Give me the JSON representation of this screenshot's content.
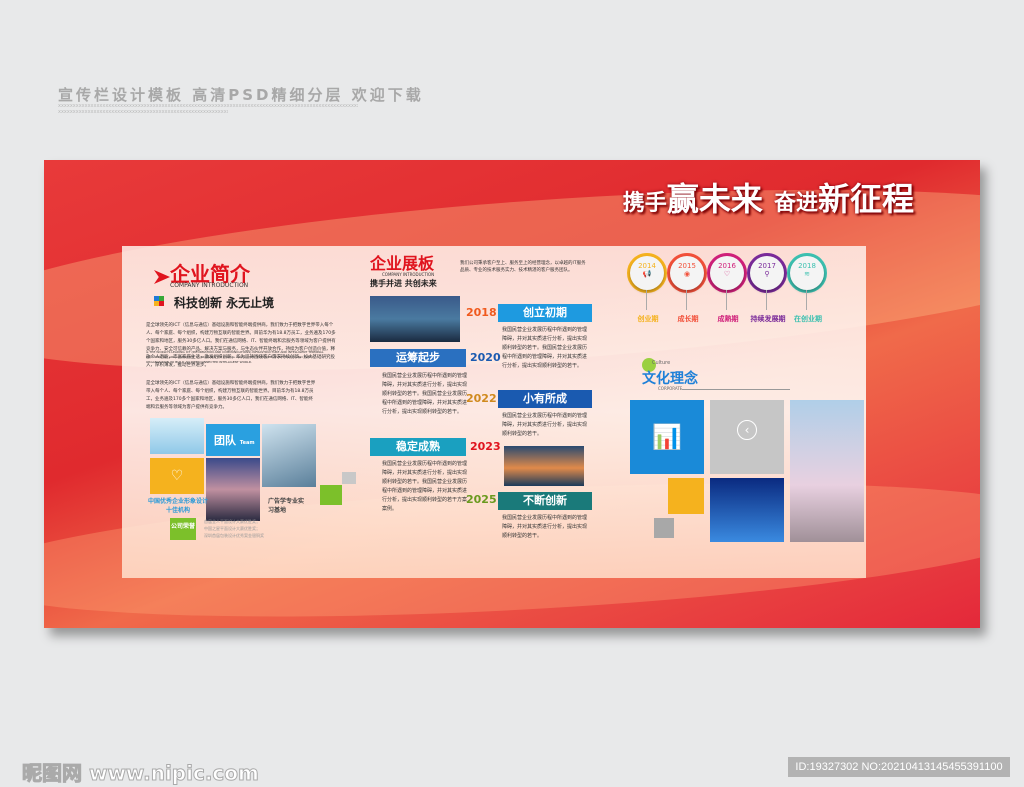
{
  "header": {
    "title": "宣传栏设计模板 高清PSD精细分层 欢迎下载",
    "filler": "xxxxxxxxxxxxxxxxxxxxxxxxxxxxxxxxxxxxxxxxxxxxxxxxxxxxxxxxxxxxxxxxxxxxxxxxxxxxxxxxxxxxxxxxxxxxxxxxxxxxxxxx"
  },
  "slogan": {
    "p1": "携手",
    "p2": "赢未来",
    "p3": "奋进",
    "p4": "新征程"
  },
  "intro": {
    "title": "企业简介",
    "en": "COMPANY INTRODUCTION",
    "subtitle": "科技创新 永无止境",
    "body1": "是全球领先的ICT（信息与通信）基础设施和智能终端提供商，我们致力于把数字世界带入每个人、每个家庭、每个组织，构建万物互联的智能世界。目前华为有18.8万员工，业务遍及170多个国家和地区，服务30多亿人口。我们在通信网络、IT、智能终端和云服务等领域为客户提供有竞争力、安全可信赖的产品、解决方案与服务，与生态伙伴开放合作，持续为客户创造价值，释放个人潜能，丰富家庭生活，激发组织创新。华为坚持围绕客户需求持续创新，加大基础研究投入，厚积薄发，推动世界进步。",
    "body_en": "is THE WORLD'S LEADING ICT (INFORMATION AND COMMUNICATIONS) INFRASTRUCTURE AND INTELLIGENT TERMINAL PROVIDER. WE ARE COMMITTED TO BRINGING THE DIGITAL WORLD INTO EVERYONE, EVERY FAMILY AND EVERY ORGANIZATION TO BUILD AN INTERCONNECTED INTELLIGENT WORLD.",
    "body2": "是全球领先的ICT（信息与通信）基础设施和智能终端提供商，我们致力于把数字世界带入每个人、每个家庭、每个组织，构建万物互联的智能世界。目前华为有18.8万员工，业务遍及170多个国家和地区，服务30多亿人口，我们在通信网络、IT、智能终端和云服务等领域为客户提供有竞争力。",
    "team": "团队",
    "team_en": "Team",
    "award": "中国优秀企业形象设计十佳机构",
    "base": "广告学专业实习基地",
    "honor": "公司荣誉",
    "honor_lines": [
      "首届全人平面设计大赛优胜奖；",
      "中国之星平面设计大赛优胜奖；",
      "深圳首届包装设计优秀案金银铜奖"
    ]
  },
  "board": {
    "title": "企业展板",
    "en": "COMPANY INTRODUCTION",
    "subtitle": "携手并进 共创未来",
    "desc": "我们公司秉承客户至上、服务至上的经营理念，以卓越的IT服务品质、专业的技术服务实力、技术精湛的客户服务团队。",
    "timeline": [
      {
        "year": "2018",
        "stage": "创立初期",
        "text": "我国民营企业发展历程中所遇到的管理障碍，并对其实质进行分析，提出实现顺利转型的若干。我国民营企业发展历程中所遇到的管理障碍，并对其实质进行分析，提出实现顺利转型的若干。"
      },
      {
        "year": "2020",
        "stage": "运筹起步",
        "text": "我国民营企业发展历程中所遇到的管理障碍，并对其实质进行分析，提出实现顺利转型的若干。我国民营企业发展历程中所遇到的管理障碍，并对其实质进行分析，提出实现顺利转型的若干。"
      },
      {
        "year": "2022",
        "stage": "小有所成",
        "text": "我国民营企业发展历程中所遇到的管理障碍，并对其实质进行分析，提出实现顺利转型的若干。"
      },
      {
        "year": "2023",
        "stage": "稳定成熟",
        "text": "我国民营企业发展历程中所遇到的管理障碍，并对其实质进行分析，提出实现顺利转型的若干。我国民营企业发展历程中所遇到的管理障碍，并对其实质进行分析，提出实现顺利转型的若干方案案例。"
      },
      {
        "year": "2025",
        "stage": "不断创新",
        "text": "我国民营企业发展历程中所遇到的管理障碍，并对其实质进行分析，提出实现顺利转型的若干。"
      }
    ]
  },
  "milestones": [
    {
      "year": "2014",
      "label": "创业期",
      "color": "#f5b21e",
      "icon": "megaphone-icon",
      "glyph": "📢"
    },
    {
      "year": "2015",
      "label": "成长期",
      "color": "#f2503a",
      "icon": "eye-icon",
      "glyph": "◉"
    },
    {
      "year": "2016",
      "label": "成熟期",
      "color": "#d0207a",
      "icon": "heart-icon",
      "glyph": "♡"
    },
    {
      "year": "2017",
      "label": "持续发展期",
      "color": "#7a2a9a",
      "icon": "magnifier-icon",
      "glyph": "⚲"
    },
    {
      "year": "2018",
      "label": "在创业期",
      "color": "#3cc0b0",
      "icon": "wifi-icon",
      "glyph": "≋"
    }
  ],
  "culture": {
    "title": "文化理念",
    "culture_en": "Culture",
    "corporate": "CORPORATE"
  },
  "footer": {
    "logo": "昵图网 www.nipic.com",
    "id": "ID:19327302 NO:20210413145455391100"
  }
}
